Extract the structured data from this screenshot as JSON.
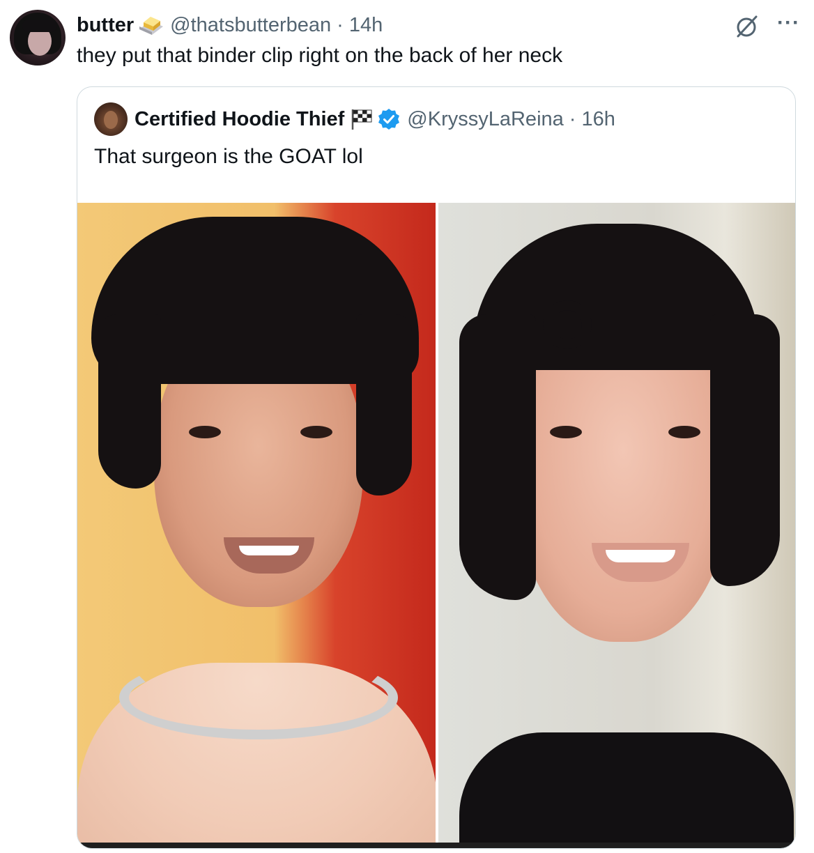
{
  "tweet": {
    "display_name": "butter",
    "badge_icon": "butter-icon",
    "handle": "@thatsbutterbean",
    "separator": "·",
    "time": "14h",
    "text": "they put that binder clip right on the back of her neck",
    "actions": {
      "grok_icon": "grok-icon",
      "more_label": "···"
    }
  },
  "quoted_tweet": {
    "display_name": "Certified Hoodie Thief",
    "flag_icon": "checkered-flag-icon",
    "verified_icon": "verified-badge-icon",
    "handle": "@KryssyLaReina",
    "separator": "·",
    "time": "16h",
    "text": "That surgeon is the GOAT lol",
    "media": [
      {
        "kind": "photo",
        "position": "left"
      },
      {
        "kind": "photo",
        "position": "right"
      }
    ]
  },
  "colors": {
    "text_primary": "#0f1419",
    "text_secondary": "#536471",
    "border": "#cfd9de",
    "verified": "#1d9bf0"
  }
}
